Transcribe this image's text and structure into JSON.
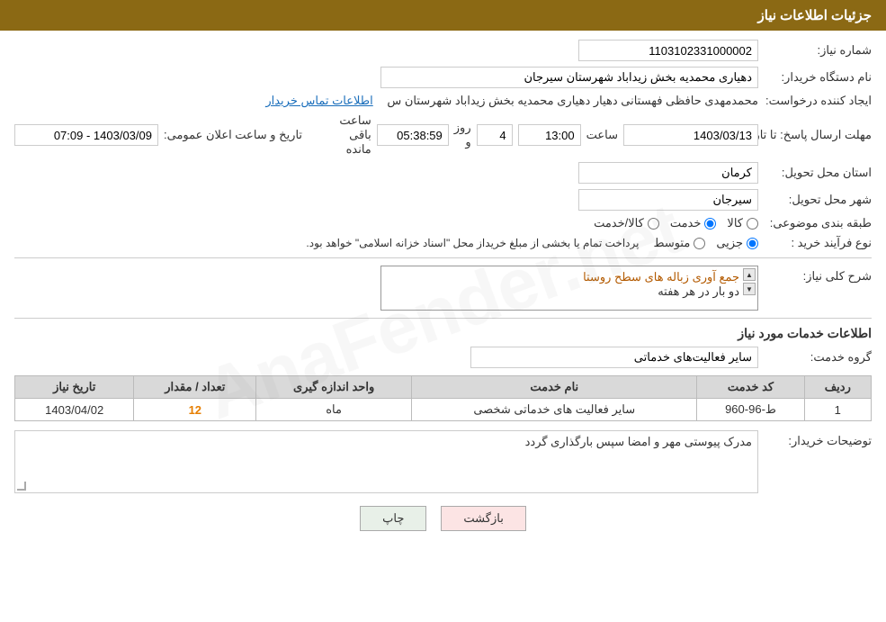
{
  "header": {
    "title": "جزئیات اطلاعات نیاز"
  },
  "fields": {
    "need_number_label": "شماره نیاز:",
    "need_number_value": "1103102331000002",
    "buyer_org_label": "نام دستگاه خریدار:",
    "buyer_org_value": "دهیاری محمدیه بخش زیداباد شهرستان سیرجان",
    "requester_label": "ایجاد کننده درخواست:",
    "requester_value": "محمدمهدی حافظی فهستانی دهیار دهیاری محمدیه بخش زیداباد شهرستان س",
    "contact_link": "اطلاعات تماس خریدار",
    "deadline_label": "مهلت ارسال پاسخ: تا تاریخ:",
    "announce_time_label": "تاریخ و ساعت اعلان عمومی:",
    "announce_time_value": "1403/03/09 - 07:09",
    "deadline_date": "1403/03/13",
    "deadline_time": "13:00",
    "deadline_days": "4",
    "deadline_hours": "05:38:59",
    "remaining_label": "روز و",
    "hours_label": "ساعت باقی مانده",
    "province_label": "استان محل تحویل:",
    "province_value": "کرمان",
    "city_label": "شهر محل تحویل:",
    "city_value": "سیرجان",
    "category_label": "طبقه بندی موضوعی:",
    "radio_kala": "کالا",
    "radio_khedmat": "خدمت",
    "radio_kala_khedmat": "کالا/خدمت",
    "purchase_type_label": "نوع فرآیند خرید :",
    "radio_jezvi": "جزیی",
    "radio_motavasset": "متوسط",
    "purchase_note": "پرداخت تمام یا بخشی از مبلغ خریداز محل \"اسناد خزانه اسلامی\" خواهد بود.",
    "need_desc_label": "شرح کلی نیاز:",
    "need_desc_text1": "جمع آوری زباله های سطح روستا",
    "need_desc_text2": "دو بار در هر هفته",
    "service_info_label": "اطلاعات خدمات مورد نیاز",
    "service_group_label": "گروه خدمت:",
    "service_group_value": "سایر فعالیت‌های خدماتی",
    "table": {
      "headers": [
        "ردیف",
        "کد خدمت",
        "نام خدمت",
        "واحد اندازه گیری",
        "تعداد / مقدار",
        "تاریخ نیاز"
      ],
      "rows": [
        {
          "row": "1",
          "code": "ط-96-960",
          "name": "سایر فعالیت های خدماتی شخصی",
          "unit": "ماه",
          "qty": "12",
          "date": "1403/04/02"
        }
      ]
    },
    "buyer_desc_label": "توضیحات خریدار:",
    "buyer_desc_text": "مدرک پیوستی مهر و امضا سپس بارگذاری گردد"
  },
  "buttons": {
    "print": "چاپ",
    "back": "بازگشت"
  }
}
